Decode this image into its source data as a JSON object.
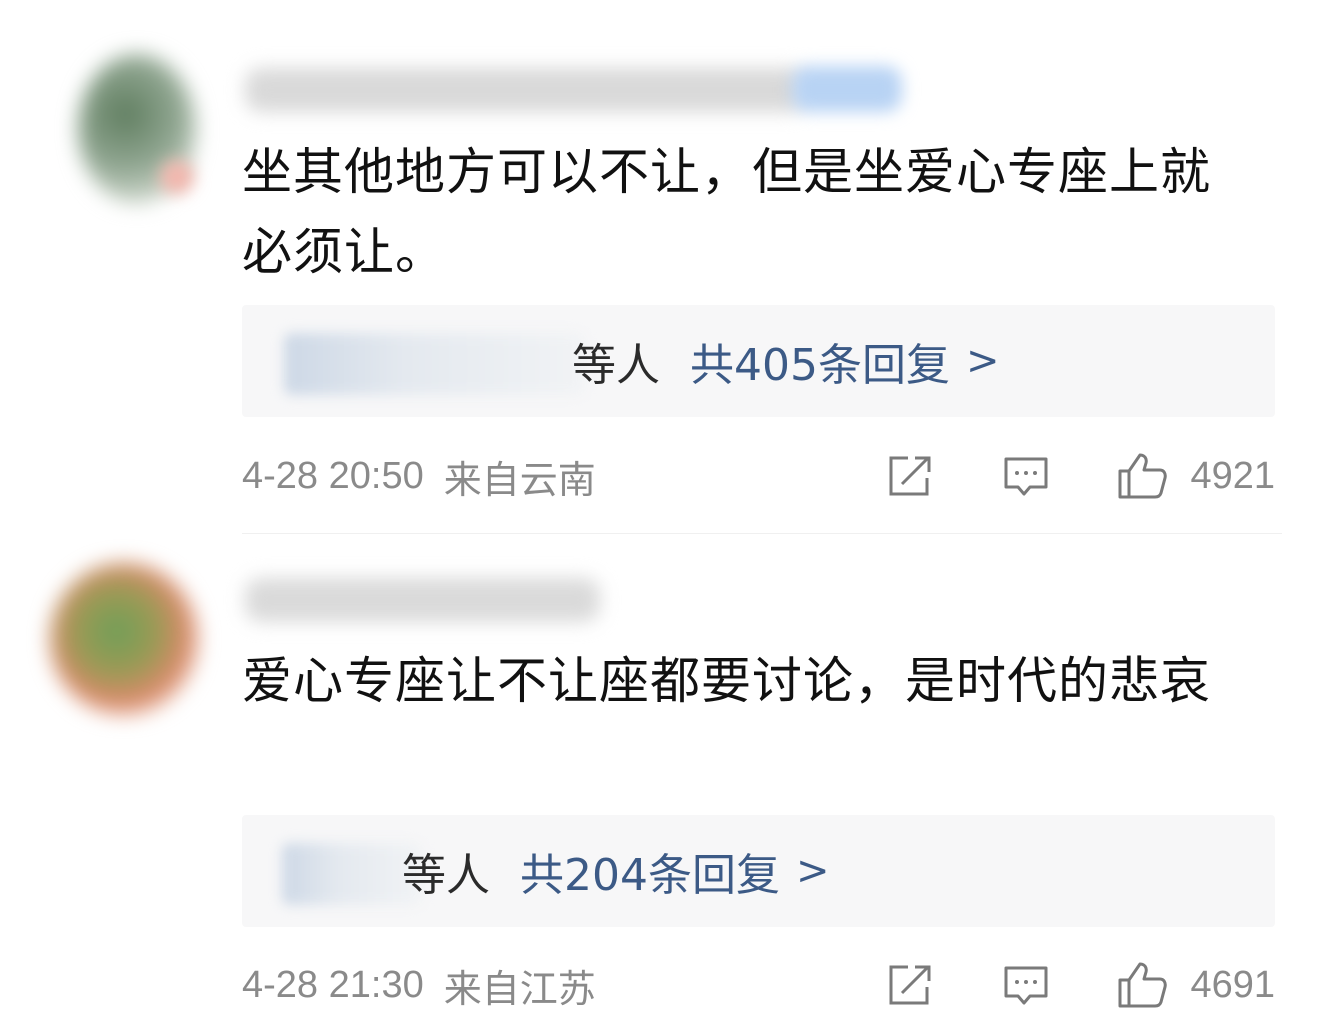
{
  "comments": [
    {
      "text": "坐其他地方可以不让，但是坐爱心专座上就必须让。",
      "replies": {
        "suffix": "等人",
        "total": "共405条回复",
        "arrow": ">"
      },
      "time": "4-28 20:50",
      "location": "来自云南",
      "likes": "4921"
    },
    {
      "text": "爱心专座让不让座都要讨论，是时代的悲哀",
      "replies": {
        "suffix": "等人",
        "total": "共204条回复",
        "arrow": ">"
      },
      "time": "4-28 21:30",
      "location": "来自江苏",
      "likes": "4691"
    }
  ],
  "icons": {
    "share": "share-icon",
    "reply": "comment-icon",
    "like": "thumbs-up-icon"
  },
  "colors": {
    "link": "#3c5a86",
    "meta": "#8a8a8a",
    "reply_bg": "#f7f7f8"
  }
}
